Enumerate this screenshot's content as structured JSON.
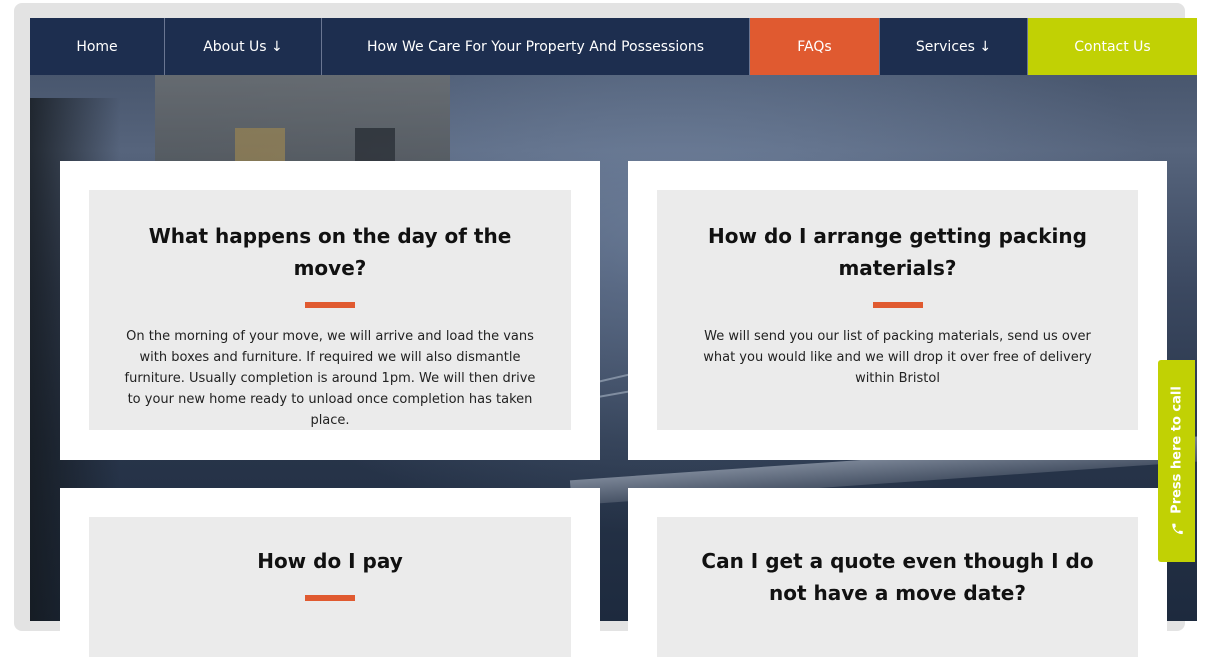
{
  "nav": {
    "items": [
      {
        "label": "Home"
      },
      {
        "label": "About Us ↓"
      },
      {
        "label": "How We Care For Your Property And Possessions"
      },
      {
        "label": "FAQs"
      },
      {
        "label": "Services ↓"
      },
      {
        "label": "Contact Us"
      }
    ]
  },
  "faqs": [
    {
      "question": "What happens on the day of the move?",
      "answer": "On the morning of your move, we will arrive and load the vans with boxes and furniture. If required we will also dismantle furniture. Usually completion is around 1pm. We will then drive to your new home ready to unload once completion has taken place."
    },
    {
      "question": "How do I arrange getting packing materials?",
      "answer": "We will send you our list of packing materials, send us over what you would like and we will drop it over free of delivery within Bristol"
    },
    {
      "question": "How do I pay",
      "answer": ""
    },
    {
      "question": "Can I get a quote even though I do not have a move date?",
      "answer": ""
    }
  ],
  "call_tab": {
    "label": "Press here to call",
    "icon": "phone-icon"
  },
  "colors": {
    "nav_bg": "#1d2e4f",
    "accent_orange": "#e05a30",
    "accent_lime": "#c1d104",
    "card_inner_bg": "#ebebeb"
  }
}
